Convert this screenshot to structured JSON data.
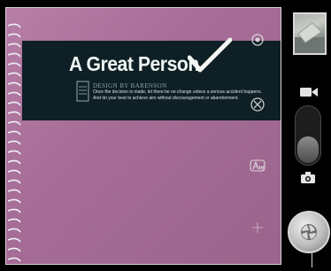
{
  "viewfinder": {
    "headline": "A Great Person",
    "doc_heading": "DESIGN BY BARENSON",
    "doc_lines": [
      "Once the decision is made, let there be no change unless a serious accident happens.",
      "And do your best to achieve aim without discouragement or abandonment."
    ],
    "banner_color": "#0e1f25",
    "surface_color": "#a66d97"
  },
  "overlay_controls": [
    {
      "name": "flash-icon"
    },
    {
      "name": "scene-mode-icon"
    },
    {
      "name": "white-balance-icon"
    },
    {
      "name": "zoom-icon"
    }
  ],
  "right_panel": {
    "thumbnail_icon": "last-photo-thumbnail",
    "video_icon": "video-camera-icon",
    "switch_mode": "camera",
    "camera_icon": "camera-icon",
    "shutter_icon": "shutter-button"
  }
}
